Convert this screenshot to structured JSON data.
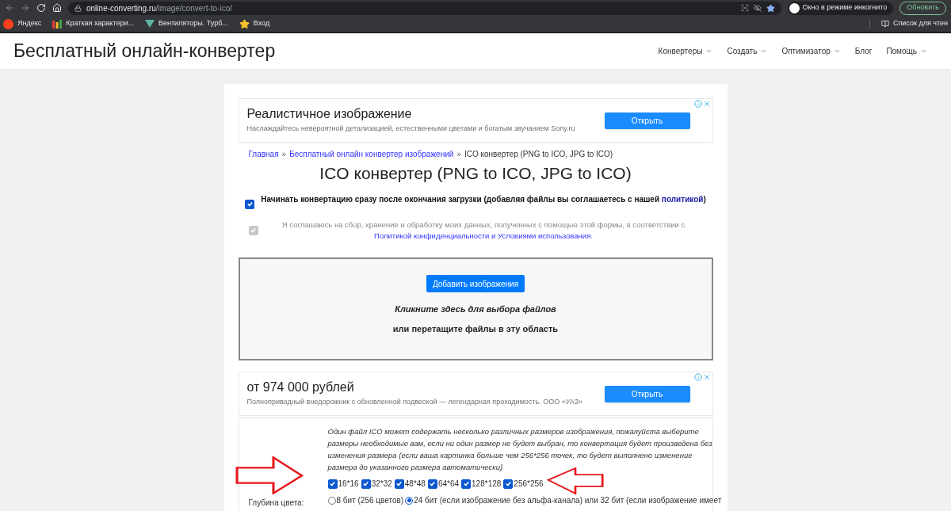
{
  "browser": {
    "url_host": "online-converting.ru",
    "url_path": "/image/convert-to-ico/",
    "bookmarks": [
      {
        "label": "Яндекс",
        "kind": "yandex"
      },
      {
        "label": "Краткая характери...",
        "kind": "bars"
      },
      {
        "label": "Вентиляторы. Турб...",
        "kind": "triangle"
      },
      {
        "label": "Вход",
        "kind": "star"
      }
    ],
    "incognito_label": "Окно в режиме инкогнито",
    "update_button": "Обновить",
    "reading_list": "Список для чтен"
  },
  "site": {
    "title": "Бесплатный онлайн-конвертер",
    "nav": [
      {
        "label": "Конвертеры",
        "dropdown": true
      },
      {
        "label": "Создать",
        "dropdown": true
      },
      {
        "label": "Оптимизатор",
        "dropdown": true
      },
      {
        "label": "Блог",
        "dropdown": false
      },
      {
        "label": "Помощь",
        "dropdown": true
      }
    ]
  },
  "ads": [
    {
      "title": "Реалистичное изображение",
      "text": "Наслаждайтесь невероятной детализацией, естественными цветами и богатым звучанием Sony.ru",
      "button": "Открыть"
    },
    {
      "title": "от 974 000 рублей",
      "text": "Полноприводный внедорожник с обновленной подвеской — легендарная проходимость. ООО «УАЗ»",
      "button": "Открыть"
    }
  ],
  "breadcrumb": [
    {
      "label": "Главная",
      "kind": "link"
    },
    {
      "label": "»",
      "kind": "separator"
    },
    {
      "label": "Бесплатный онлайн конвертер изображений",
      "kind": "link"
    },
    {
      "label": "»",
      "kind": "separator"
    },
    {
      "label": "ICO конвертер (PNG to ICO, JPG to ICO)",
      "kind": "current"
    }
  ],
  "heading": "ICO конвертер (PNG to ICO, JPG to ICO)",
  "options": [
    {
      "kind": "bold",
      "checked": true,
      "disabled": false,
      "text": "Начинать конвертацию сразу после окончания загрузки (добавляя файлы вы соглашаетесь с нашей",
      "link": "политикой",
      "after": ")"
    },
    {
      "kind": "muted",
      "checked": true,
      "disabled": true,
      "text": "Я соглашаюсь на сбор, хранение и обработку моих данных, полученных с помощью этой формы, в соответствии с",
      "link": "Политикой конфиденциальности и Условиями использования",
      "after": "."
    }
  ],
  "upload": {
    "button": "Добавить изображения",
    "hint_bold": "Кликните здесь для выбора файлов",
    "hint": "или перетащите файлы в эту область"
  },
  "sizes": {
    "description": "Один файл ICO может содержать несколько различных размеров изображения, пожалуйста выберите размеры необходимые вам, если ни один размер не будет выбран, то конвертация будет произведена без изменения размера (если ваша картинка больше чем 256*256 точек, то будет выполнено изменение размера до указанного размера автоматически)",
    "items": [
      {
        "label": "16*16",
        "checked": true
      },
      {
        "label": "32*32",
        "checked": true
      },
      {
        "label": "48*48",
        "checked": true
      },
      {
        "label": "64*64",
        "checked": true
      },
      {
        "label": "128*128",
        "checked": true
      },
      {
        "label": "256*256",
        "checked": true
      }
    ]
  },
  "color_depth": {
    "label": "Глубина цвета:",
    "options": [
      {
        "label": "8 бит (256 цветов)",
        "selected": false
      },
      {
        "label": "24 бит (если изображение без альфа-канала) или 32 бит (если изображение имеет",
        "selected": true
      }
    ]
  }
}
